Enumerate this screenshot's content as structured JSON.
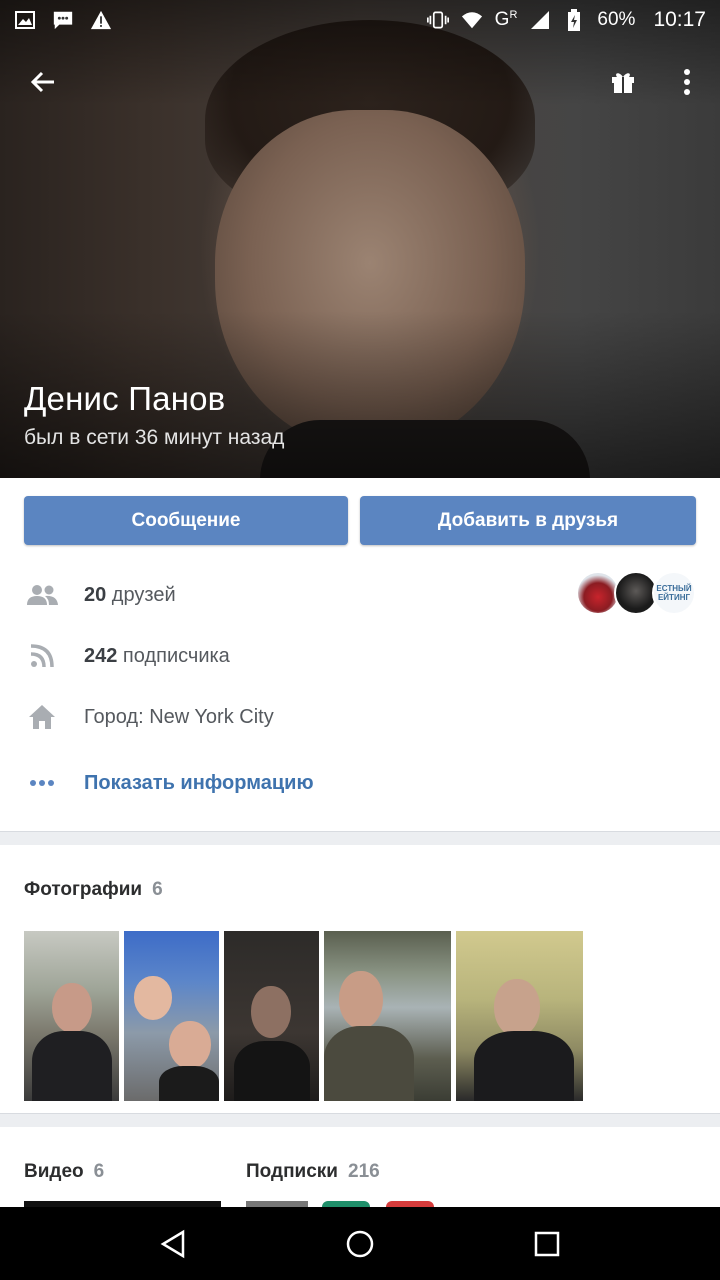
{
  "statusbar": {
    "battery": "60%",
    "network": "G",
    "network_sup": "R",
    "time": "10:17",
    "icons_left": [
      "image-icon",
      "message-icon",
      "warning-icon"
    ],
    "icons_right": [
      "vibrate-icon",
      "wifi-icon",
      "signal-icon",
      "battery-icon"
    ]
  },
  "profile": {
    "name": "Денис Панов",
    "last_seen": "был в сети 36 минут назад"
  },
  "actions": {
    "message_label": "Сообщение",
    "add_friend_label": "Добавить в друзья"
  },
  "info": {
    "friends_count": "20",
    "friends_label": " друзей",
    "followers_count": "242",
    "followers_label": " подписчика",
    "city": "Город: New York City",
    "show_info": "Показать информацию",
    "friend_avatar_text": "ЕСТНЫЙ\nЕЙТИНГ"
  },
  "photos": {
    "title": "Фотографии",
    "count": "6"
  },
  "videos": {
    "title": "Видео",
    "count": "6"
  },
  "subscriptions": {
    "title": "Подписки",
    "count": "216"
  },
  "colors": {
    "accent": "#5b85c1",
    "link": "#3f73ae",
    "navbar": "#000000"
  }
}
